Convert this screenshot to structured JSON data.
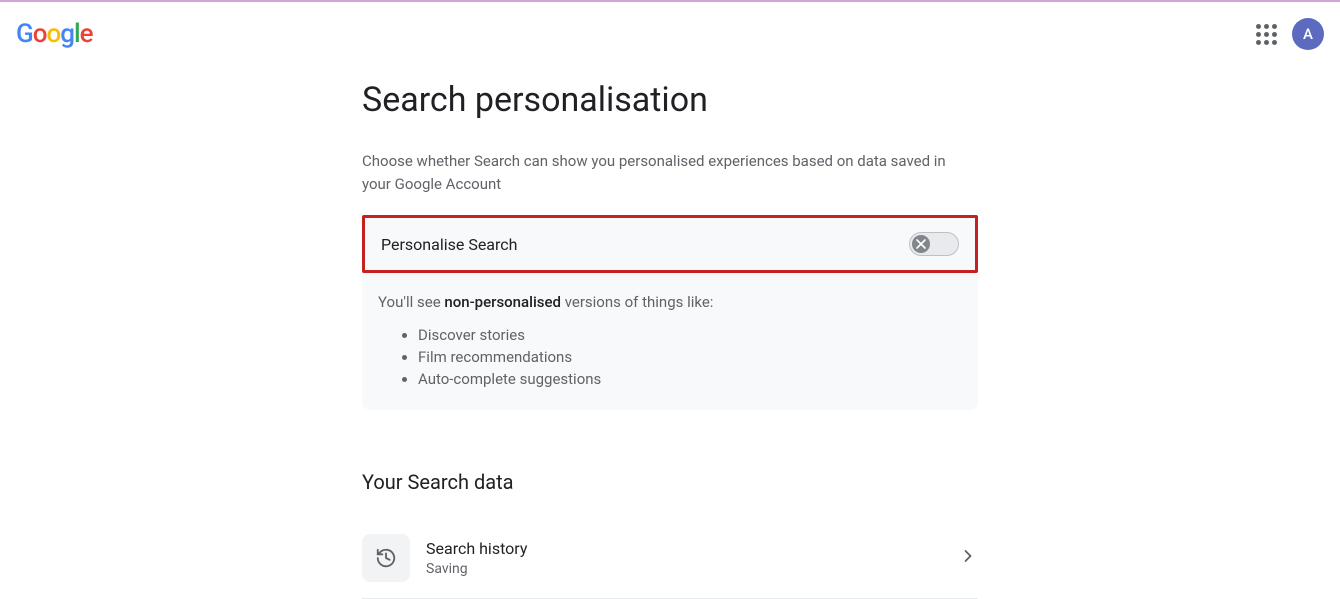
{
  "header": {
    "logo": "Google",
    "avatar_initial": "A"
  },
  "page": {
    "title": "Search personalisation",
    "subtitle": "Choose whether Search can show you personalised experiences based on data saved in your Google Account"
  },
  "personalise_card": {
    "toggle_label": "Personalise Search",
    "toggle_state": "off",
    "desc_prefix": "You'll see ",
    "desc_bold": "non-personalised",
    "desc_suffix": " versions of things like:",
    "items": [
      "Discover stories",
      "Film recommendations",
      "Auto-complete suggestions"
    ]
  },
  "search_data": {
    "section_title": "Your Search data",
    "rows": [
      {
        "title": "Search history",
        "subtitle": "Saving"
      }
    ]
  }
}
